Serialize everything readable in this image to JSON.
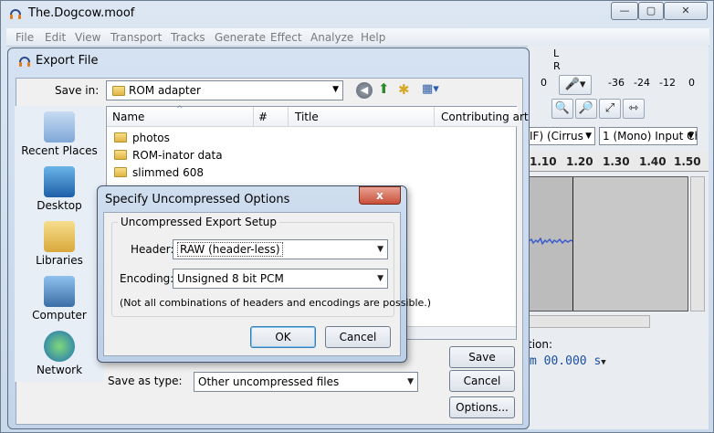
{
  "main_window": {
    "title": "The.Dogcow.moof",
    "controls": {
      "minimize": "—",
      "maximize": "▢",
      "close": "✕"
    },
    "menu": [
      "File",
      "Edit",
      "View",
      "Transport",
      "Tracks",
      "Generate",
      "Effect",
      "Analyze",
      "Help"
    ],
    "meter": {
      "l": "L",
      "r": "R",
      "zero": "0",
      "scale": [
        "-36",
        "-24",
        "-12",
        "0"
      ]
    },
    "device_host": "IF) (Cirrus",
    "input_channels": "1 (Mono) Input Ch",
    "timeline_ticks": [
      "1.10",
      "1.20",
      "1.30",
      "1.40",
      "1.50"
    ],
    "position_label": "tion:",
    "position_value": "m 00.000 s"
  },
  "export_dialog": {
    "title": "Export File",
    "save_in_label": "Save in:",
    "save_in_value": "ROM adapter",
    "places": [
      "Recent Places",
      "Desktop",
      "Libraries",
      "Computer",
      "Network"
    ],
    "columns": [
      "Name",
      "#",
      "Title",
      "Contributing art"
    ],
    "files": [
      "photos",
      "ROM-inator data",
      "slimmed 608"
    ],
    "save_as_type_label": "Save as type:",
    "save_as_type_value": "Other uncompressed files",
    "buttons": {
      "save": "Save",
      "cancel": "Cancel",
      "options": "Options..."
    }
  },
  "uncompressed_dialog": {
    "title": "Specify Uncompressed Options",
    "close": "x",
    "group_label": "Uncompressed Export Setup",
    "header_label": "Header:",
    "header_value": "RAW (header-less)",
    "encoding_label": "Encoding:",
    "encoding_value": "Unsigned 8 bit PCM",
    "note": "(Not all combinations of headers and encodings are possible.)",
    "ok": "OK",
    "cancel": "Cancel"
  }
}
